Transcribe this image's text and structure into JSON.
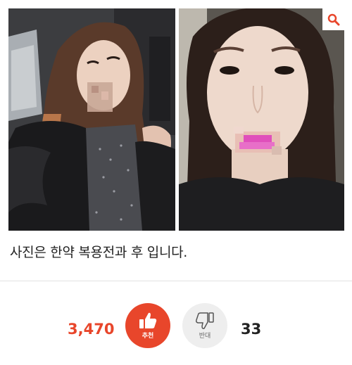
{
  "photos": {
    "before_alt": "before",
    "after_alt": "after"
  },
  "zoom": {
    "icon": "magnifier-icon"
  },
  "caption": "사진은 한약 복용전과 후 입니다.",
  "vote": {
    "up_count": "3,470",
    "up_label": "추천",
    "up_icon": "thumbs-up-icon",
    "down_label": "반대",
    "down_icon": "thumbs-down-icon",
    "down_count": "33",
    "up_color": "#e8462b",
    "down_bg": "#eeeeee"
  }
}
